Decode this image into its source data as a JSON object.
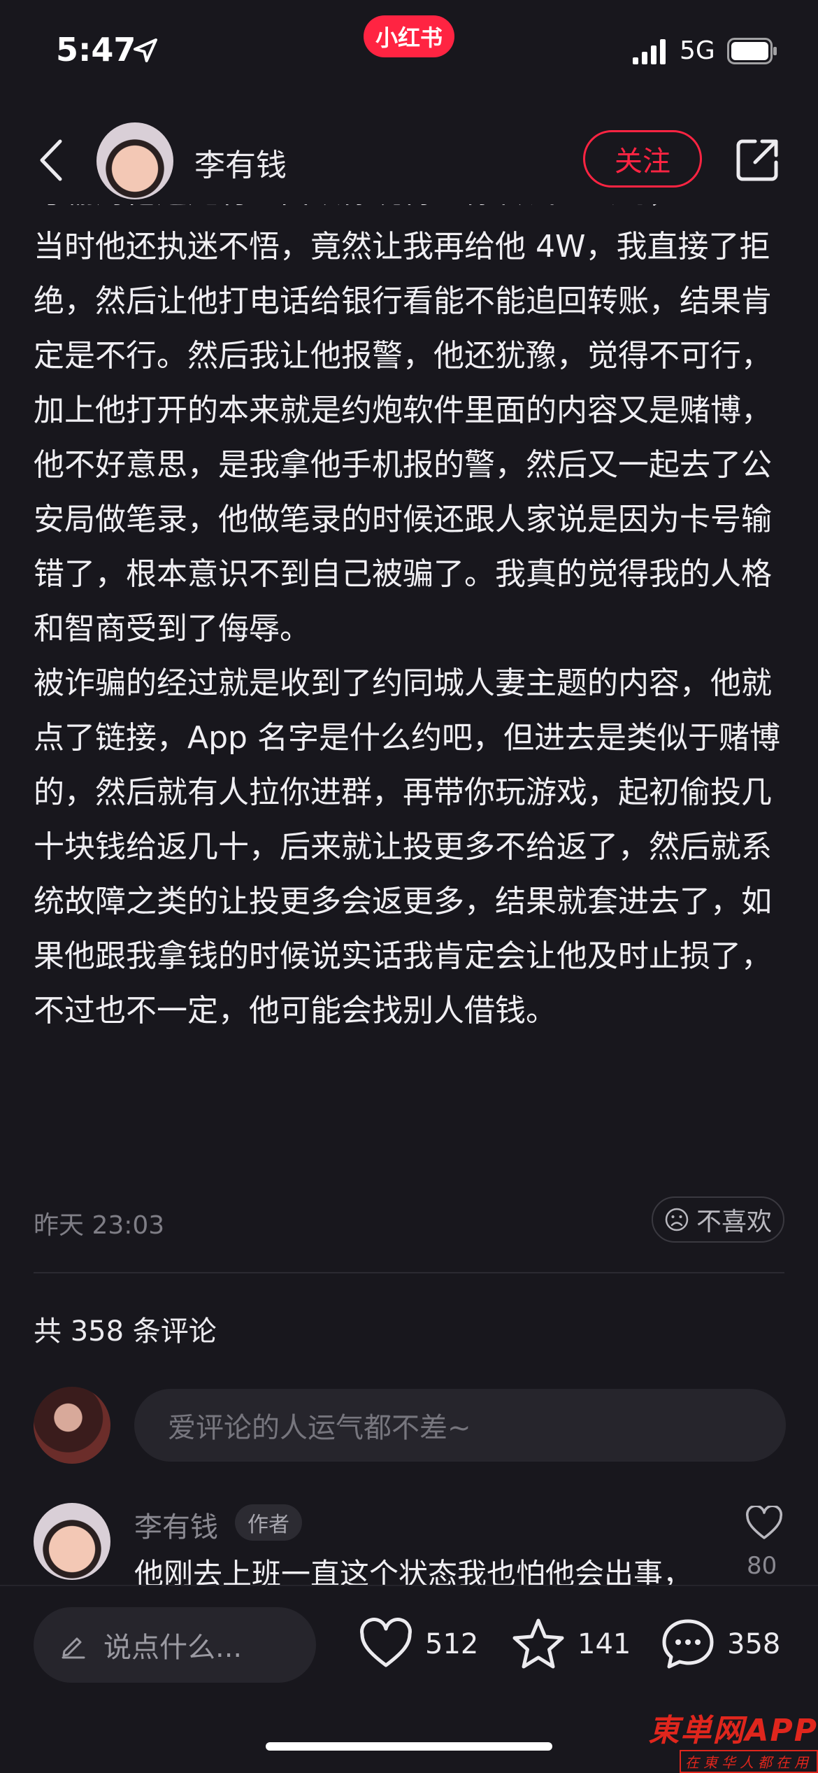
{
  "status_bar": {
    "time": "5:47",
    "brand": "小红书",
    "network": "5G",
    "icons": [
      "location-arrow-icon",
      "signal-icon",
      "battery-icon"
    ]
  },
  "header": {
    "author_name": "李有钱",
    "follow_label": "关注",
    "icons": [
      "back-icon",
      "share-icon"
    ]
  },
  "post": {
    "partial_top_line": "号输对他还是有理由跟你说得让你转钱过去的，",
    "paragraph_1": "当时他还执迷不悟，竟然让我再给他 4W，我直接了拒绝，然后让他打电话给银行看能不能追回转账，结果肯定是不行。然后我让他报警，他还犹豫，觉得不可行，加上他打开的本来就是约炮软件里面的内容又是赌博，他不好意思，是我拿他手机报的警，然后又一起去了公安局做笔录，他做笔录的时候还跟人家说是因为卡号输错了，根本意识不到自己被骗了。我真的觉得我的人格和智商受到了侮辱。",
    "paragraph_2": "被诈骗的经过就是收到了约同城人妻主题的内容，他就点了链接，App 名字是什么约吧，但进去是类似于赌博的，然后就有人拉你进群，再带你玩游戏，起初偷投几十块钱给返几十，后来就让投更多不给返了，然后就系统故障之类的让投更多会返更多，结果就套进去了，如果他跟我拿钱的时候说实话我肯定会让他及时止损了，不过也不一定，他可能会找别人借钱。",
    "time": "昨天 23:03",
    "dislike_label": "不喜欢"
  },
  "comments": {
    "count_label": "共 358 条评论",
    "input_placeholder": "爱评论的人运气都不差~",
    "items": [
      {
        "name": "李有钱",
        "badge": "作者",
        "text": "他刚去上班一直这个状态我也怕他会出事，",
        "likes": "80"
      }
    ]
  },
  "bottom_bar": {
    "input_placeholder": "说点什么...",
    "likes": "512",
    "collects": "141",
    "comments": "358"
  },
  "watermark": {
    "name": "東単网APP",
    "slogan": "在東华人都在用"
  },
  "colors": {
    "background": "#18171d",
    "accent": "#ff2442",
    "text": "#ecebef",
    "muted": "#7f7e86"
  }
}
